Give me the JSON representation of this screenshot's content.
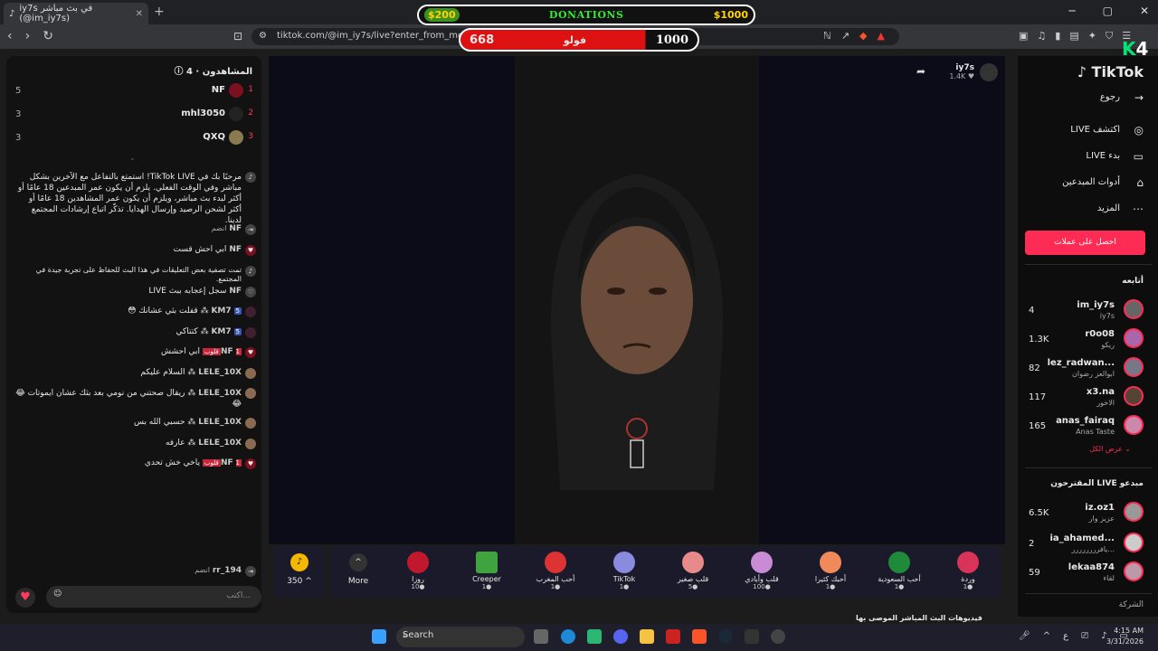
{
  "browser": {
    "tab_title": "iy7s في بث مباشر (@im_iy7s)",
    "url": "tiktok.com/@im_iy7s/live?enter_from_merge=oth",
    "url_tail": "to"
  },
  "overlay": {
    "donations_left": "$200",
    "donations_label": "DONATIONS",
    "donations_right": "$1000",
    "follow_count": "668",
    "follow_label": "فولو",
    "follow_goal": "1000",
    "brand": "K",
    "brand_num": "4"
  },
  "viewers": {
    "title": "المشاهدون",
    "count": "4",
    "list": [
      {
        "rank": "1",
        "name": "NF",
        "count": "5"
      },
      {
        "rank": "2",
        "name": "mhl3050",
        "count": "3"
      },
      {
        "rank": "3",
        "name": "QXQ",
        "count": "3"
      }
    ]
  },
  "chat": [
    {
      "user": "",
      "text": "مرحبًا بك في TikTok LIVE! استمتع بالتفاعل مع الآخرين بشكل مباشر وفي الوقت الفعلي. يلزم أن يكون عمر المبدعين 18 عامًا أو أكثر لبدء بث مباشر، ويلزم أن يكون عمر المشاهدين 18 عامًا أو أكثر لشحن الرصيد وإرسال الهدايا. تذكّر اتباع إرشادات المجتمع لدينا."
    },
    {
      "user": "NF",
      "text": "انضم"
    },
    {
      "user": "NF",
      "text": "ابي احش قست"
    },
    {
      "user": "",
      "text": "تمت تصفية بعض التعليقات في هذا البث للحفاظ على تجربة جيدة في المجتمع."
    },
    {
      "user": "NF",
      "text": "سجل إعجابه ببث LIVE"
    },
    {
      "user": "KM7",
      "text": "قفلت بثي عشانك 😳",
      "tag": "5"
    },
    {
      "user": "KM7",
      "text": "كتتاكي",
      "tag": "5"
    },
    {
      "user": "NF",
      "text": "ابي احشش",
      "tag2": "1 قلوب"
    },
    {
      "user": "LELE_10X",
      "text": "السلام عليكم"
    },
    {
      "user": "LELE_10X",
      "text": "ريقال صحتني من نومي بعد بثك عشان ايموتات 😂😂"
    },
    {
      "user": "LELE_10X",
      "text": "حسبي الله بس"
    },
    {
      "user": "LELE_10X",
      "text": "عارفه"
    },
    {
      "user": "NF",
      "text": "ياخي خش تحدي",
      "tag2": "1 قلوب"
    },
    {
      "user": "rr_194",
      "text": "انضم"
    }
  ],
  "chat_input": {
    "placeholder": "اكتب..."
  },
  "streamer": {
    "name": "iy7s",
    "likes": "1.4K"
  },
  "coins": {
    "value": "350"
  },
  "gifts": [
    {
      "name": "وردة",
      "price": "1"
    },
    {
      "name": "أحب السعودية",
      "price": "1"
    },
    {
      "name": "أحبك كثيرا",
      "price": "1"
    },
    {
      "name": "قلب وأيادي",
      "price": "100"
    },
    {
      "name": "قلب صغير",
      "price": "5"
    },
    {
      "name": "TikTok",
      "price": "1"
    },
    {
      "name": "أحب المغرب",
      "price": "1"
    },
    {
      "name": "Creeper",
      "price": "1"
    },
    {
      "name": "روزا",
      "price": "10"
    }
  ],
  "more_label": "More",
  "caption": "فيديوهات البث المباشر الموصى بها",
  "sidebar": {
    "logo": "TikTok",
    "back": "رجوع",
    "nav": [
      {
        "label": "اكتشف LIVE"
      },
      {
        "label": "بدء LIVE"
      },
      {
        "label": "أدوات المبدعين"
      },
      {
        "label": "المزيد"
      }
    ],
    "coins_btn": "احصل على عملات",
    "following_title": "أتابعه",
    "following": [
      {
        "name": "im_iy7s",
        "sub": "iy7s",
        "count": "4"
      },
      {
        "name": "r0o08",
        "sub": "ريكو",
        "count": "1.3K"
      },
      {
        "name": "lez_radwan...",
        "sub": "ابوالعز رضوان",
        "count": "82"
      },
      {
        "name": "x3.na",
        "sub": "الاخور",
        "count": "117"
      },
      {
        "name": "anas_fairaq",
        "sub": "Anas Taste",
        "count": "165"
      }
    ],
    "see_all": "عرض الكل",
    "suggested_title": "مبدعو LIVE المقترحون",
    "suggested": [
      {
        "name": "iz.oz1",
        "sub": "عزيز وار",
        "count": "6.5K"
      },
      {
        "name": "ia_ahamed...",
        "sub": "يافرررررررر...",
        "count": "2"
      },
      {
        "name": "lekaa874",
        "sub": "لقاء",
        "count": "59"
      }
    ],
    "company": "الشركة"
  },
  "taskbar": {
    "search": "Search",
    "time": "4:15 AM",
    "date": "3/31/2026",
    "lang": "ع"
  }
}
